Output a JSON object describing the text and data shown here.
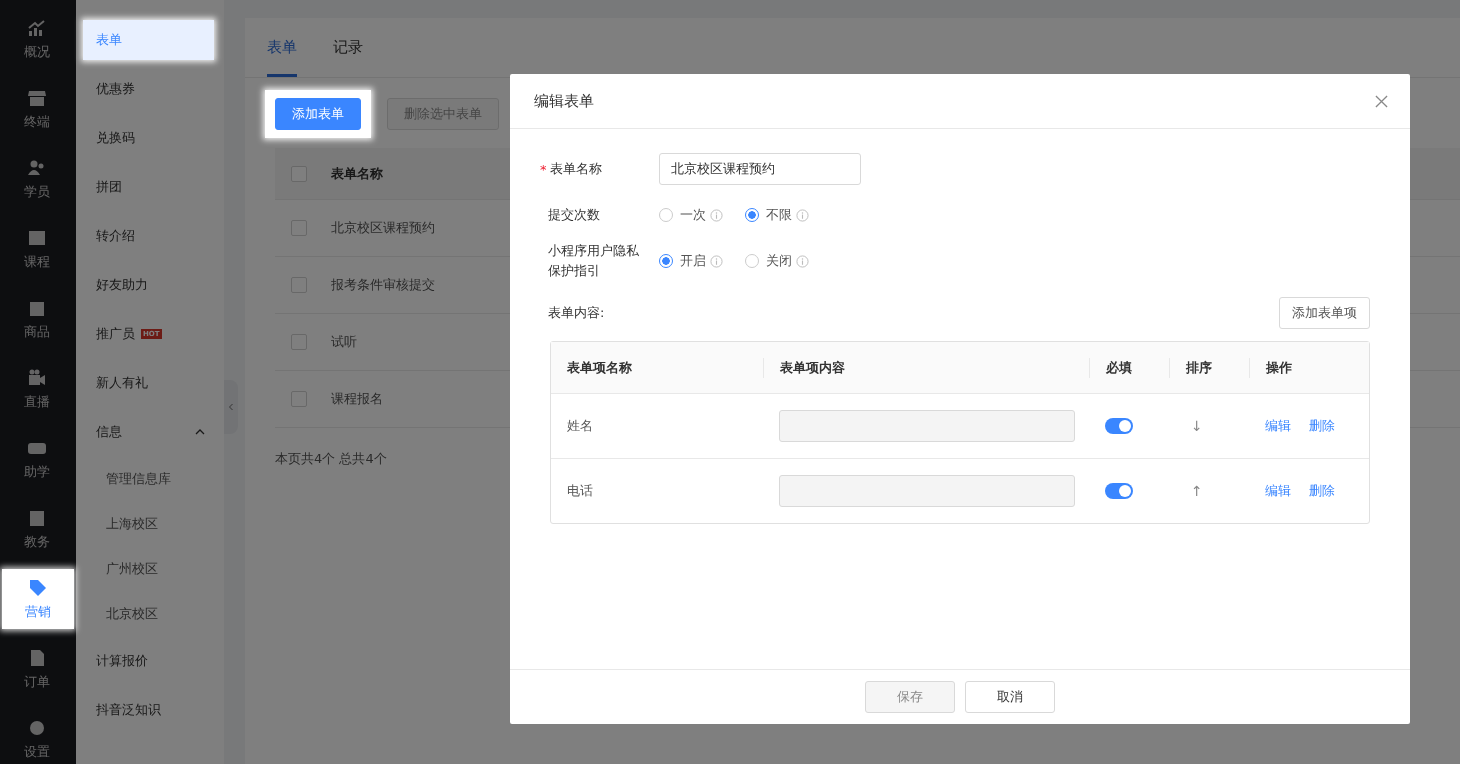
{
  "rail": [
    {
      "label": "概况",
      "selected": false,
      "spotlight": false
    },
    {
      "label": "终端",
      "selected": false,
      "spotlight": false
    },
    {
      "label": "学员",
      "selected": false,
      "spotlight": false
    },
    {
      "label": "课程",
      "selected": false,
      "spotlight": false
    },
    {
      "label": "商品",
      "selected": false,
      "spotlight": false
    },
    {
      "label": "直播",
      "selected": false,
      "spotlight": false
    },
    {
      "label": "助学",
      "selected": false,
      "spotlight": false
    },
    {
      "label": "教务",
      "selected": false,
      "spotlight": false
    },
    {
      "label": "营销",
      "selected": true,
      "spotlight": true
    },
    {
      "label": "订单",
      "selected": false,
      "spotlight": false
    },
    {
      "label": "设置",
      "selected": false,
      "spotlight": false
    }
  ],
  "submenu": [
    {
      "label": "表单",
      "selected": true,
      "spotlight": true
    },
    {
      "label": "优惠券",
      "selected": false,
      "spotlight": false
    },
    {
      "label": "兑换码",
      "selected": false,
      "spotlight": false
    },
    {
      "label": "拼团",
      "selected": false,
      "spotlight": false
    },
    {
      "label": "转介绍",
      "selected": false,
      "spotlight": false
    },
    {
      "label": "好友助力",
      "selected": false,
      "spotlight": false
    },
    {
      "label": "推广员",
      "selected": false,
      "spotlight": false,
      "badge": "HOT"
    },
    {
      "label": "新人有礼",
      "selected": false,
      "spotlight": false
    },
    {
      "label": "信息",
      "selected": false,
      "spotlight": false,
      "expanded": true,
      "children": [
        {
          "label": "管理信息库",
          "selected": false
        },
        {
          "label": "上海校区",
          "selected": false
        },
        {
          "label": "广州校区",
          "selected": false
        },
        {
          "label": "北京校区",
          "selected": false
        }
      ]
    },
    {
      "label": "计算报价",
      "selected": false,
      "spotlight": false
    },
    {
      "label": "抖音泛知识",
      "selected": false,
      "spotlight": false
    }
  ],
  "tabs": [
    {
      "label": "表单",
      "selected": true
    },
    {
      "label": "记录",
      "selected": false
    }
  ],
  "toolbar": [
    {
      "label": "添加表单",
      "kind": "primary",
      "disabled": false,
      "spotlight": true
    },
    {
      "label": "删除选中表单",
      "kind": "default",
      "disabled": true,
      "spotlight": false
    }
  ],
  "table": {
    "columns": [
      "表单名称"
    ],
    "all_checked": false,
    "rows": [
      {
        "name": "北京校区课程预约",
        "checked": false
      },
      {
        "name": "报考条件审核提交",
        "checked": false
      },
      {
        "name": "试听",
        "checked": false
      },
      {
        "name": "课程报名",
        "checked": false
      }
    ]
  },
  "footer": "本页共4个 总共4个",
  "modal": {
    "title": "编辑表单",
    "name_field": {
      "label": "表单名称",
      "required_mark": "*",
      "value": "北京校区课程预约"
    },
    "radio_groups": [
      {
        "label": "提交次数",
        "options": [
          {
            "label": "一次",
            "selected": false
          },
          {
            "label": "不限",
            "selected": true
          }
        ]
      },
      {
        "label": "小程序用户隐私保护指引",
        "options": [
          {
            "label": "开启",
            "selected": true
          },
          {
            "label": "关闭",
            "selected": false
          }
        ]
      }
    ],
    "content_label": "表单内容:",
    "add_button": "添加表单项",
    "columns": [
      "表单项名称",
      "表单项内容",
      "必填",
      "排序",
      "操作"
    ],
    "rows": [
      {
        "name": "姓名",
        "required": true,
        "sort": "↓",
        "actions": [
          "编辑",
          "删除"
        ]
      },
      {
        "name": "电话",
        "required": true,
        "sort": "↑",
        "actions": [
          "编辑",
          "删除"
        ]
      }
    ],
    "buttons": [
      {
        "label": "保存",
        "disabled": true
      },
      {
        "label": "取消",
        "disabled": false
      }
    ]
  }
}
